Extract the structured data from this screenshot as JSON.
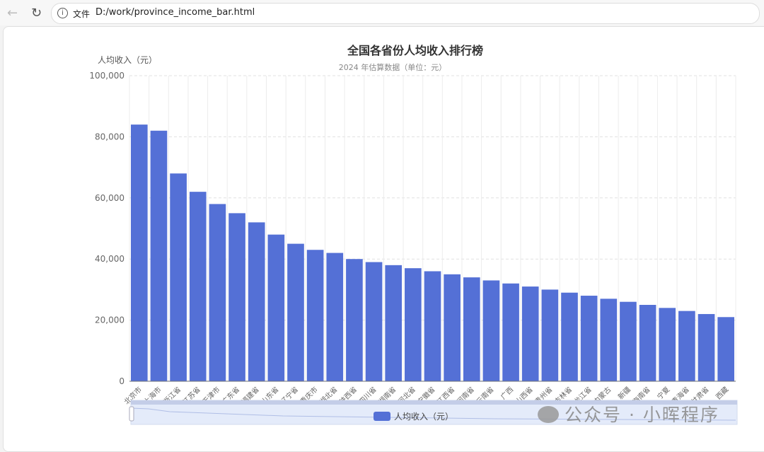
{
  "browser": {
    "file_label": "文件",
    "url": "D:/work/province_income_bar.html"
  },
  "watermark": "公众号 · 小晖程序",
  "chart_data": {
    "type": "bar",
    "title": "全国各省份人均收入排行榜",
    "subtitle": "2024 年估算数据（单位：元）",
    "ylabel": "人均收入（元）",
    "ylim": [
      0,
      100000
    ],
    "yticks": [
      "0",
      "20,000",
      "40,000",
      "60,000",
      "80,000",
      "100,000"
    ],
    "grid": true,
    "legend": {
      "entries": [
        "人均收入（元）"
      ],
      "placement": "bottom"
    },
    "color": "#5470d6",
    "categories": [
      "北京市",
      "上海市",
      "浙江省",
      "江苏省",
      "天津市",
      "广东省",
      "福建省",
      "山东省",
      "辽宁省",
      "重庆市",
      "湖北省",
      "陕西省",
      "四川省",
      "湖南省",
      "河北省",
      "安徽省",
      "江西省",
      "河南省",
      "云南省",
      "广西",
      "山西省",
      "贵州省",
      "吉林省",
      "黑龙江省",
      "内蒙古",
      "新疆",
      "海南省",
      "宁夏",
      "青海省",
      "甘肃省",
      "西藏"
    ],
    "series": [
      {
        "name": "人均收入（元）",
        "values": [
          84000,
          82000,
          68000,
          62000,
          58000,
          55000,
          52000,
          48000,
          45000,
          43000,
          42000,
          40000,
          39000,
          38000,
          37000,
          36000,
          35000,
          34000,
          33000,
          32000,
          31000,
          30000,
          29000,
          28000,
          27000,
          26000,
          25000,
          24000,
          23000,
          22000,
          21000
        ]
      }
    ],
    "datazoom": {
      "start": 0,
      "end": 100
    }
  }
}
